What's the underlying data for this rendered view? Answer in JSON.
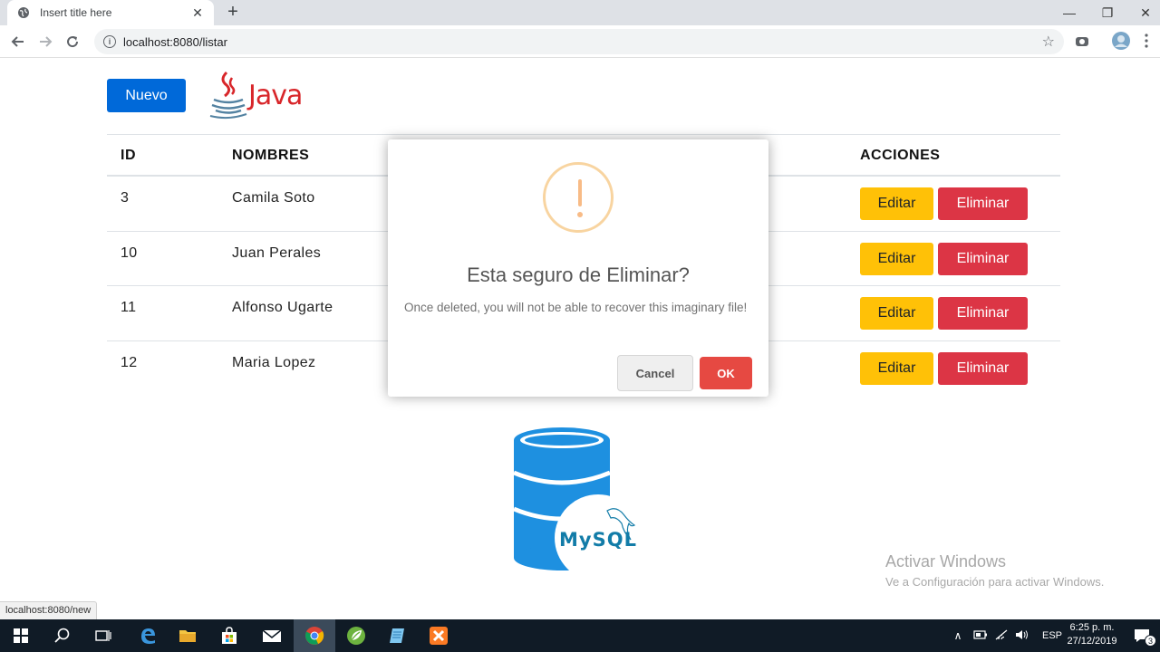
{
  "browser": {
    "tab_title": "Insert title here",
    "tab_close": "✕",
    "new_tab": "+",
    "url": "localhost:8080/listar",
    "status_url": "localhost:8080/new",
    "window_controls": {
      "minimize": "—",
      "restore": "❐",
      "close": "✕"
    }
  },
  "page": {
    "new_button": "Nuevo",
    "java_logo_text": "Java",
    "mysql_logo_text": "MySQL",
    "table": {
      "headers": {
        "id": "ID",
        "names": "NOMBRES",
        "actions": "ACCIONES"
      },
      "rows": [
        {
          "id": "3",
          "name": "Camila Soto"
        },
        {
          "id": "10",
          "name": "Juan Perales"
        },
        {
          "id": "11",
          "name": "Alfonso Ugarte"
        },
        {
          "id": "12",
          "name": "Maria Lopez"
        }
      ],
      "edit_label": "Editar",
      "delete_label": "Eliminar"
    }
  },
  "modal": {
    "title": "Esta seguro de Eliminar?",
    "text": "Once deleted, you will not be able to recover this imaginary file!",
    "cancel": "Cancel",
    "ok": "OK"
  },
  "watermark": {
    "title": "Activar Windows",
    "subtitle": "Ve a Configuración para activar Windows."
  },
  "taskbar": {
    "language": "ESP",
    "time": "6:25 p. m.",
    "date": "27/12/2019",
    "notification_count": "3"
  },
  "colors": {
    "primary": "#0069d9",
    "warning": "#ffc107",
    "danger": "#dc3545",
    "ok_button": "#e64942",
    "warning_icon": "#f8bb86",
    "mysql_blue": "#1e90e0"
  }
}
